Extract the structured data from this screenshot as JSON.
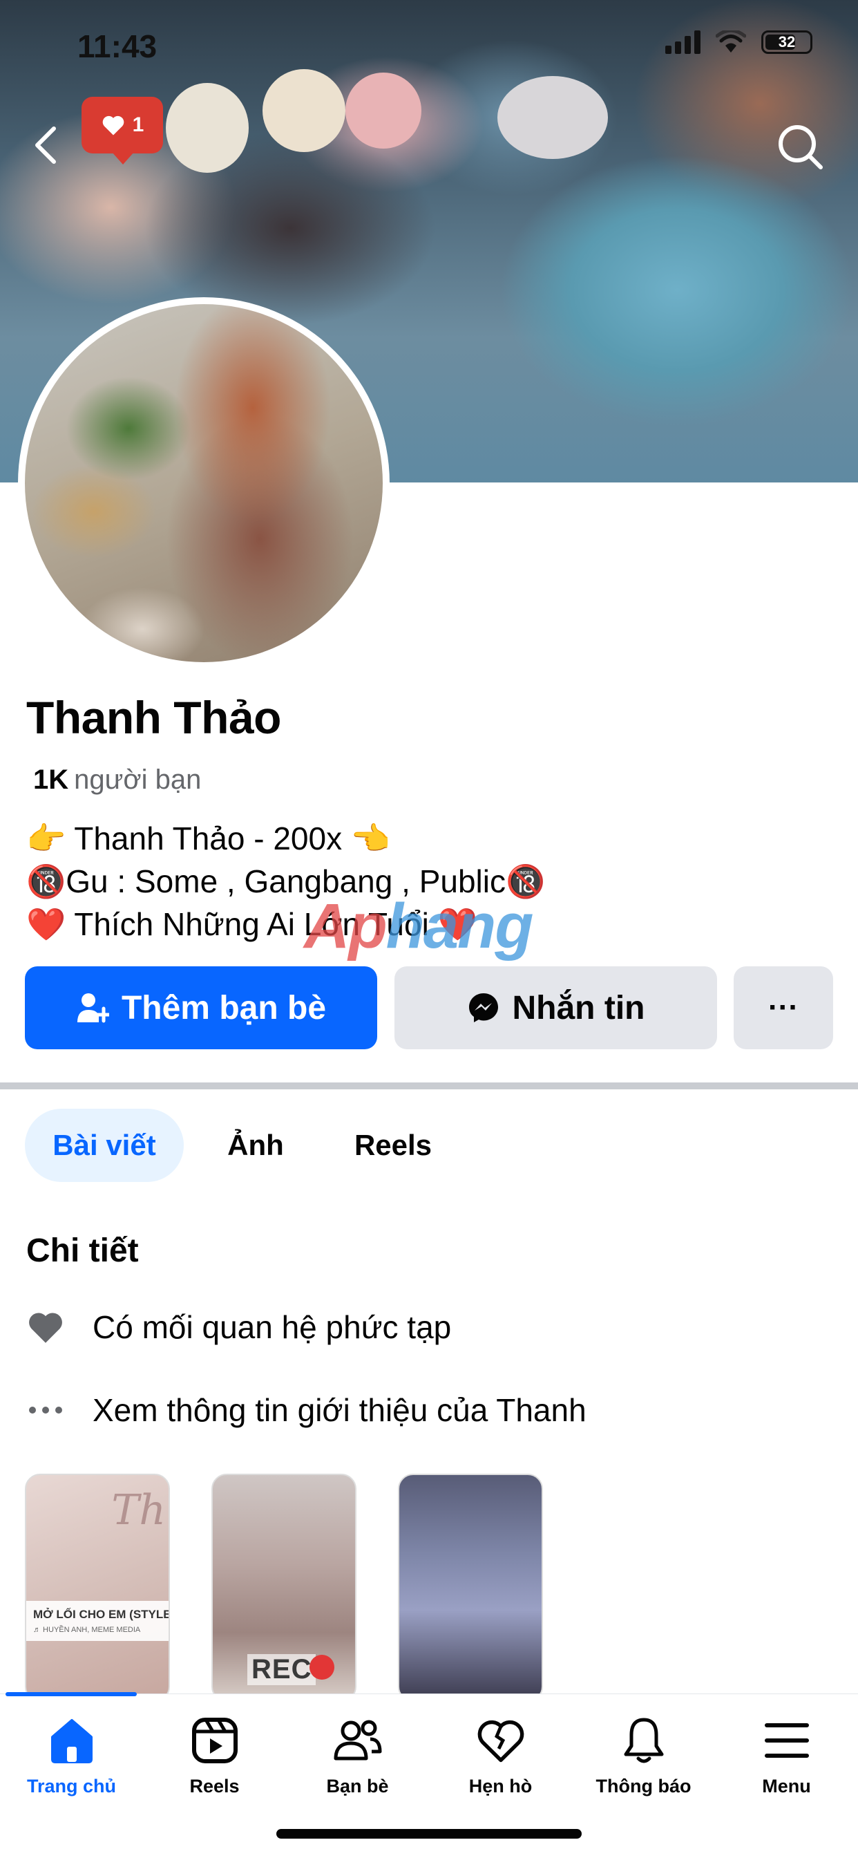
{
  "status_bar": {
    "time": "11:43",
    "battery": "32"
  },
  "header": {
    "like_count": "1"
  },
  "profile": {
    "name": "Thanh Thảo",
    "friends_count": "1K",
    "friends_label": "người bạn",
    "bio": [
      "👉 Thanh Thảo - 200x 👈",
      "🔞Gu : Some , Gangbang , Public🔞",
      "❤️ Thích Những Ai Lớn Tuổi ❤️"
    ]
  },
  "watermark": {
    "part1": "Ap",
    "part2": "hang"
  },
  "actions": {
    "add_friend": "Thêm bạn bè",
    "message": "Nhắn tin",
    "more": "···"
  },
  "tabs": [
    {
      "label": "Bài viết",
      "active": true
    },
    {
      "label": "Ảnh",
      "active": false
    },
    {
      "label": "Reels",
      "active": false
    }
  ],
  "details": {
    "title": "Chi tiết",
    "relationship": "Có mối quan hệ phức tạp",
    "see_intro": "Xem thông tin giới thiệu của Thanh"
  },
  "stories": [
    {
      "caption": "MỞ LỐI CHO EM (STYLE HU",
      "subcaption": "♬ HUYỀN ANH, MEME MEDIA",
      "overlay": "Th"
    },
    {
      "overlay": "REC"
    },
    {
      "overlay": ""
    }
  ],
  "bottom_nav": [
    {
      "label": "Trang chủ",
      "icon": "home-icon",
      "active": true
    },
    {
      "label": "Reels",
      "icon": "reels-icon",
      "active": false
    },
    {
      "label": "Bạn bè",
      "icon": "friends-icon",
      "active": false
    },
    {
      "label": "Hẹn hò",
      "icon": "dating-heart-icon",
      "active": false
    },
    {
      "label": "Thông báo",
      "icon": "bell-icon",
      "active": false
    },
    {
      "label": "Menu",
      "icon": "menu-icon",
      "active": false
    }
  ],
  "colors": {
    "accent": "#0866ff",
    "button_gray": "#e4e6eb",
    "badge_red": "#d93b31"
  }
}
